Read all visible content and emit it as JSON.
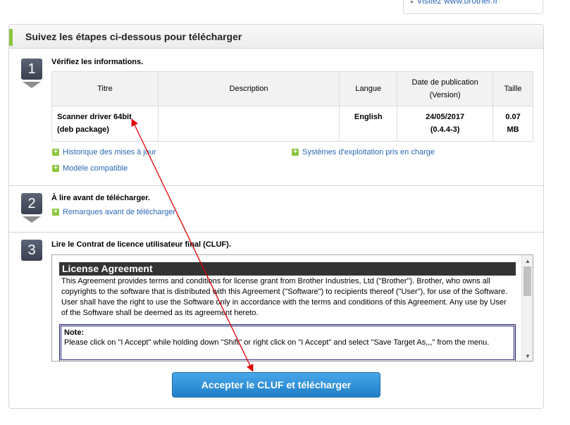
{
  "top_link": {
    "text": "Visitez www.brother.fr"
  },
  "panel": {
    "title": "Suivez les étapes ci-dessous pour télécharger"
  },
  "steps": [
    {
      "number": "1",
      "title": "Vérifiez les informations."
    },
    {
      "number": "2",
      "title": "À lire avant de télécharger."
    },
    {
      "number": "3",
      "title": "Lire le Contrat de licence utilisateur final (CLUF)."
    }
  ],
  "table": {
    "headers": {
      "title": "Titre",
      "description": "Description",
      "language": "Langue",
      "date_line1": "Date de publication",
      "date_line2": "(Version)",
      "size": "Taille"
    },
    "row": {
      "title_line1": "Scanner driver 64bit",
      "title_line2": "(deb package)",
      "description": "",
      "language": "English",
      "date": "24/05/2017",
      "version": "(0.4.4-3)",
      "size_value": "0.07",
      "size_unit": "MB"
    }
  },
  "links": {
    "history": "Historique des mises à jour",
    "supported_os": "Systèmes d'exploitation pris en charge",
    "compatible_model": "Modèle compatible",
    "remarks": "Remarques avant de télécharger"
  },
  "license": {
    "heading": "License Agreement",
    "body": "This Agreement provides terms and conditions for license grant from Brother Industries, Ltd (\"Brother\"). Brother, who owns all copyrights to the software that is distributed with this Agreement (\"Software\") to recipients thereof (\"User\"), for use of the Software. User shall have the right to use the Software only in accordance with the terms and conditions of this Agreement. Any use by User of the Software shall be deemed as its agreement hereto.",
    "note_title": "Note:",
    "note_text": "Please click on \"I Accept\" while holding down \"Shift\" or right click on \"I Accept\" and select \"Save Target As,,,\" from the menu."
  },
  "accept_button": {
    "label": "Accepter le CLUF et télécharger"
  },
  "colors": {
    "accent_green": "#8dc63f",
    "link_blue": "#2a66b4",
    "button_blue": "#1f7fc8",
    "annotation_red": "#e00000"
  },
  "icons": {
    "plus": "plus-square-icon",
    "arrow": "chevron-right-icon"
  }
}
